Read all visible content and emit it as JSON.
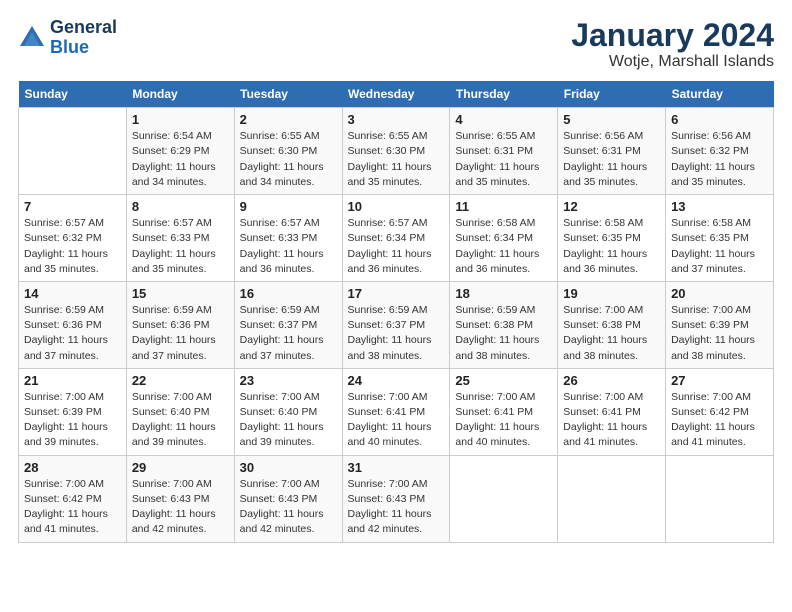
{
  "header": {
    "logo_general": "General",
    "logo_blue": "Blue",
    "title": "January 2024",
    "subtitle": "Wotje, Marshall Islands"
  },
  "days_of_week": [
    "Sunday",
    "Monday",
    "Tuesday",
    "Wednesday",
    "Thursday",
    "Friday",
    "Saturday"
  ],
  "weeks": [
    [
      {
        "day": "",
        "sunrise": "",
        "sunset": "",
        "daylight": ""
      },
      {
        "day": "1",
        "sunrise": "Sunrise: 6:54 AM",
        "sunset": "Sunset: 6:29 PM",
        "daylight": "Daylight: 11 hours and 34 minutes."
      },
      {
        "day": "2",
        "sunrise": "Sunrise: 6:55 AM",
        "sunset": "Sunset: 6:30 PM",
        "daylight": "Daylight: 11 hours and 34 minutes."
      },
      {
        "day": "3",
        "sunrise": "Sunrise: 6:55 AM",
        "sunset": "Sunset: 6:30 PM",
        "daylight": "Daylight: 11 hours and 35 minutes."
      },
      {
        "day": "4",
        "sunrise": "Sunrise: 6:55 AM",
        "sunset": "Sunset: 6:31 PM",
        "daylight": "Daylight: 11 hours and 35 minutes."
      },
      {
        "day": "5",
        "sunrise": "Sunrise: 6:56 AM",
        "sunset": "Sunset: 6:31 PM",
        "daylight": "Daylight: 11 hours and 35 minutes."
      },
      {
        "day": "6",
        "sunrise": "Sunrise: 6:56 AM",
        "sunset": "Sunset: 6:32 PM",
        "daylight": "Daylight: 11 hours and 35 minutes."
      }
    ],
    [
      {
        "day": "7",
        "sunrise": "Sunrise: 6:57 AM",
        "sunset": "Sunset: 6:32 PM",
        "daylight": "Daylight: 11 hours and 35 minutes."
      },
      {
        "day": "8",
        "sunrise": "Sunrise: 6:57 AM",
        "sunset": "Sunset: 6:33 PM",
        "daylight": "Daylight: 11 hours and 35 minutes."
      },
      {
        "day": "9",
        "sunrise": "Sunrise: 6:57 AM",
        "sunset": "Sunset: 6:33 PM",
        "daylight": "Daylight: 11 hours and 36 minutes."
      },
      {
        "day": "10",
        "sunrise": "Sunrise: 6:57 AM",
        "sunset": "Sunset: 6:34 PM",
        "daylight": "Daylight: 11 hours and 36 minutes."
      },
      {
        "day": "11",
        "sunrise": "Sunrise: 6:58 AM",
        "sunset": "Sunset: 6:34 PM",
        "daylight": "Daylight: 11 hours and 36 minutes."
      },
      {
        "day": "12",
        "sunrise": "Sunrise: 6:58 AM",
        "sunset": "Sunset: 6:35 PM",
        "daylight": "Daylight: 11 hours and 36 minutes."
      },
      {
        "day": "13",
        "sunrise": "Sunrise: 6:58 AM",
        "sunset": "Sunset: 6:35 PM",
        "daylight": "Daylight: 11 hours and 37 minutes."
      }
    ],
    [
      {
        "day": "14",
        "sunrise": "Sunrise: 6:59 AM",
        "sunset": "Sunset: 6:36 PM",
        "daylight": "Daylight: 11 hours and 37 minutes."
      },
      {
        "day": "15",
        "sunrise": "Sunrise: 6:59 AM",
        "sunset": "Sunset: 6:36 PM",
        "daylight": "Daylight: 11 hours and 37 minutes."
      },
      {
        "day": "16",
        "sunrise": "Sunrise: 6:59 AM",
        "sunset": "Sunset: 6:37 PM",
        "daylight": "Daylight: 11 hours and 37 minutes."
      },
      {
        "day": "17",
        "sunrise": "Sunrise: 6:59 AM",
        "sunset": "Sunset: 6:37 PM",
        "daylight": "Daylight: 11 hours and 38 minutes."
      },
      {
        "day": "18",
        "sunrise": "Sunrise: 6:59 AM",
        "sunset": "Sunset: 6:38 PM",
        "daylight": "Daylight: 11 hours and 38 minutes."
      },
      {
        "day": "19",
        "sunrise": "Sunrise: 7:00 AM",
        "sunset": "Sunset: 6:38 PM",
        "daylight": "Daylight: 11 hours and 38 minutes."
      },
      {
        "day": "20",
        "sunrise": "Sunrise: 7:00 AM",
        "sunset": "Sunset: 6:39 PM",
        "daylight": "Daylight: 11 hours and 38 minutes."
      }
    ],
    [
      {
        "day": "21",
        "sunrise": "Sunrise: 7:00 AM",
        "sunset": "Sunset: 6:39 PM",
        "daylight": "Daylight: 11 hours and 39 minutes."
      },
      {
        "day": "22",
        "sunrise": "Sunrise: 7:00 AM",
        "sunset": "Sunset: 6:40 PM",
        "daylight": "Daylight: 11 hours and 39 minutes."
      },
      {
        "day": "23",
        "sunrise": "Sunrise: 7:00 AM",
        "sunset": "Sunset: 6:40 PM",
        "daylight": "Daylight: 11 hours and 39 minutes."
      },
      {
        "day": "24",
        "sunrise": "Sunrise: 7:00 AM",
        "sunset": "Sunset: 6:41 PM",
        "daylight": "Daylight: 11 hours and 40 minutes."
      },
      {
        "day": "25",
        "sunrise": "Sunrise: 7:00 AM",
        "sunset": "Sunset: 6:41 PM",
        "daylight": "Daylight: 11 hours and 40 minutes."
      },
      {
        "day": "26",
        "sunrise": "Sunrise: 7:00 AM",
        "sunset": "Sunset: 6:41 PM",
        "daylight": "Daylight: 11 hours and 41 minutes."
      },
      {
        "day": "27",
        "sunrise": "Sunrise: 7:00 AM",
        "sunset": "Sunset: 6:42 PM",
        "daylight": "Daylight: 11 hours and 41 minutes."
      }
    ],
    [
      {
        "day": "28",
        "sunrise": "Sunrise: 7:00 AM",
        "sunset": "Sunset: 6:42 PM",
        "daylight": "Daylight: 11 hours and 41 minutes."
      },
      {
        "day": "29",
        "sunrise": "Sunrise: 7:00 AM",
        "sunset": "Sunset: 6:43 PM",
        "daylight": "Daylight: 11 hours and 42 minutes."
      },
      {
        "day": "30",
        "sunrise": "Sunrise: 7:00 AM",
        "sunset": "Sunset: 6:43 PM",
        "daylight": "Daylight: 11 hours and 42 minutes."
      },
      {
        "day": "31",
        "sunrise": "Sunrise: 7:00 AM",
        "sunset": "Sunset: 6:43 PM",
        "daylight": "Daylight: 11 hours and 42 minutes."
      },
      {
        "day": "",
        "sunrise": "",
        "sunset": "",
        "daylight": ""
      },
      {
        "day": "",
        "sunrise": "",
        "sunset": "",
        "daylight": ""
      },
      {
        "day": "",
        "sunrise": "",
        "sunset": "",
        "daylight": ""
      }
    ]
  ]
}
